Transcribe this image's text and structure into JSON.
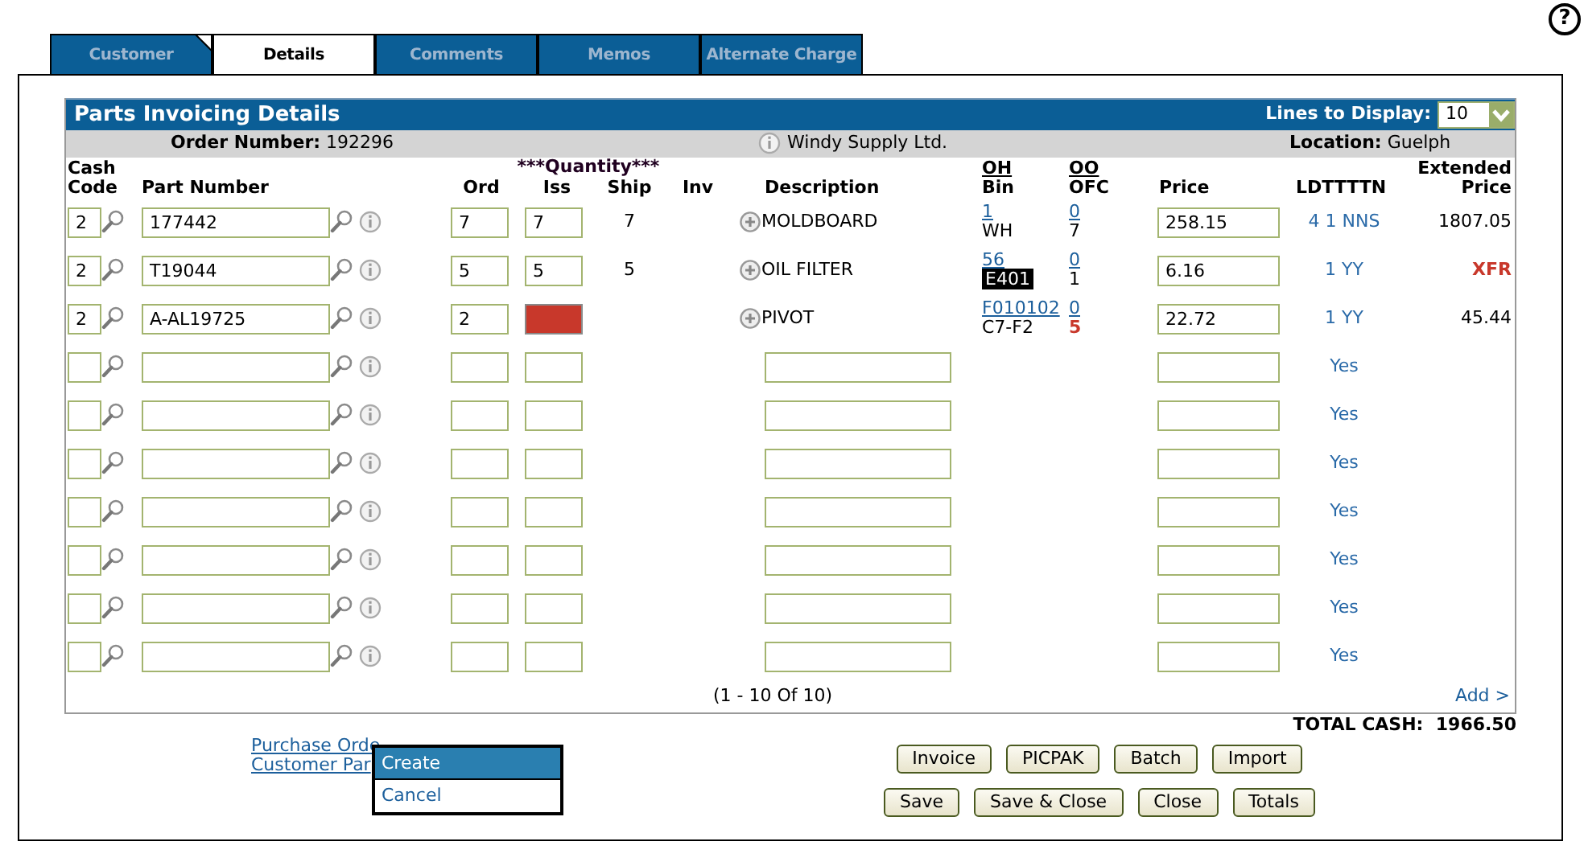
{
  "help": {
    "glyph": "?"
  },
  "tabs": [
    {
      "label": "Customer",
      "selected": false,
      "flagged": true
    },
    {
      "label": "Details",
      "selected": true,
      "flagged": false
    },
    {
      "label": "Comments",
      "selected": false,
      "flagged": false
    },
    {
      "label": "Memos",
      "selected": false,
      "flagged": false
    },
    {
      "label": "Alternate Charge",
      "selected": false,
      "flagged": false
    }
  ],
  "panel": {
    "title": "Parts Invoicing Details",
    "lines_to_display": {
      "label": "Lines to Display:",
      "value": "10"
    },
    "info_bar": {
      "order_label": "Order Number:",
      "order_number": "192296",
      "customer": "Windy Supply Ltd.",
      "location_label": "Location:",
      "location": "Guelph"
    },
    "quantity_group": "***Quantity***",
    "columns": [
      {
        "lines": [
          "Cash",
          "Code"
        ],
        "linked": false
      },
      {
        "lines": [
          "Part Number"
        ],
        "linked": false
      },
      {
        "lines": [
          "Ord"
        ],
        "linked": false
      },
      {
        "lines": [
          "Iss"
        ],
        "linked": false
      },
      {
        "lines": [
          "Ship"
        ],
        "linked": false
      },
      {
        "lines": [
          "Inv"
        ],
        "linked": false
      },
      {
        "lines": [
          "Description"
        ],
        "linked": false
      },
      {
        "lines": [
          "OH",
          "Bin"
        ],
        "linked": true
      },
      {
        "lines": [
          "OO",
          "OFC"
        ],
        "linked": true
      },
      {
        "lines": [
          "Price"
        ],
        "linked": false
      },
      {
        "lines": [
          "LDTTTTN"
        ],
        "linked": false
      },
      {
        "lines": [
          "Extended",
          "Price"
        ],
        "linked": false
      }
    ],
    "rows": [
      {
        "kind": "line",
        "cash_code": "2",
        "part_number": "177442",
        "ord": "7",
        "iss": "7",
        "iss_error": false,
        "ship": "7",
        "description": "MOLDBOARD",
        "oh": "1",
        "bin": "WH",
        "bin_highlighted": false,
        "oo": "0",
        "ofc": "7",
        "ofc_alert": false,
        "price": "258.15",
        "ldtttn": "4 1 NNS",
        "extended_price": "1807.05",
        "extended_alert": false
      },
      {
        "kind": "line",
        "cash_code": "2",
        "part_number": "T19044",
        "ord": "5",
        "iss": "5",
        "iss_error": false,
        "ship": "5",
        "description": "OIL FILTER",
        "oh": "56",
        "bin": "E401",
        "bin_highlighted": true,
        "oo": "0",
        "ofc": "1",
        "ofc_alert": false,
        "price": "6.16",
        "ldtttn": "1 YY",
        "extended_price": "XFR",
        "extended_alert": true
      },
      {
        "kind": "line",
        "cash_code": "2",
        "part_number": "A-AL19725",
        "ord": "2",
        "iss_error": true,
        "description": "PIVOT",
        "oh": "F010102",
        "bin": "C7-F2",
        "bin_highlighted": false,
        "oo": "0",
        "ofc": "5",
        "ofc_alert": true,
        "price": "22.72",
        "ldtttn": "1 YY",
        "extended_price": "45.44",
        "extended_alert": false
      },
      {
        "kind": "blank",
        "ldtttn": "Yes"
      },
      {
        "kind": "blank",
        "ldtttn": "Yes"
      },
      {
        "kind": "blank",
        "ldtttn": "Yes"
      },
      {
        "kind": "blank",
        "ldtttn": "Yes"
      },
      {
        "kind": "blank",
        "ldtttn": "Yes"
      },
      {
        "kind": "blank",
        "ldtttn": "Yes"
      },
      {
        "kind": "blank",
        "ldtttn": "Yes"
      }
    ],
    "pager": "(1 - 10 Of 10)",
    "add_link": "Add >"
  },
  "total_cash": {
    "label": "TOTAL CASH:",
    "value": "1966.50"
  },
  "links": [
    "Purchase Orde",
    "Customer Par"
  ],
  "menu": [
    {
      "label": "Create",
      "selected": true
    },
    {
      "label": "Cancel",
      "selected": false
    }
  ],
  "button_rows": [
    [
      "Invoice",
      "PICPAK",
      "Batch",
      "Import"
    ],
    [
      "Save",
      "Save & Close",
      "Close",
      "Totals"
    ]
  ]
}
